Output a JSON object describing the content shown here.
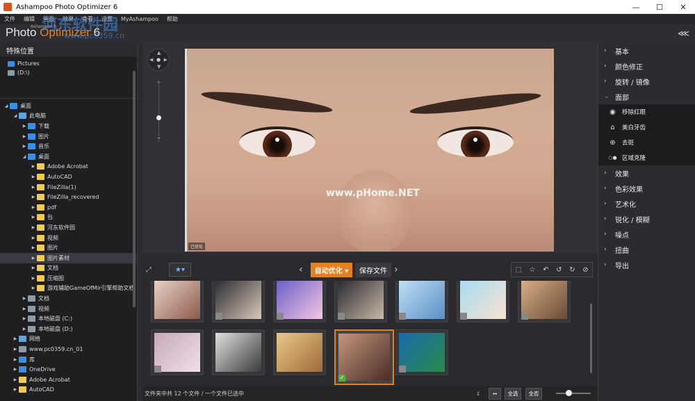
{
  "window": {
    "title": "Ashampoo Photo Optimizer 6",
    "min": "—",
    "max": "☐",
    "close": "✕"
  },
  "menu": [
    "文件",
    "编辑",
    "画面",
    "效果",
    "查看",
    "设置",
    "MyAshampoo",
    "帮助"
  ],
  "logo": {
    "prefix": "Photo ",
    "accent": "Optimizer",
    "version": " 6",
    "brand": "Ashampoo®"
  },
  "watermark": {
    "main": "河东软件园",
    "url": "www.pc0359.cn"
  },
  "left": {
    "title": "特殊位置",
    "special": [
      "Pictures",
      "(D:\\)"
    ],
    "tree": [
      {
        "label": "桌面",
        "indent": 0,
        "arrow": "◢",
        "icon": "blue"
      },
      {
        "label": "此电脑",
        "indent": 1,
        "arrow": "◢",
        "icon": "pc"
      },
      {
        "label": "下载",
        "indent": 2,
        "arrow": "▶",
        "icon": "blue"
      },
      {
        "label": "图片",
        "indent": 2,
        "arrow": "▶",
        "icon": "blue"
      },
      {
        "label": "音乐",
        "indent": 2,
        "arrow": "▶",
        "icon": "blue"
      },
      {
        "label": "桌面",
        "indent": 2,
        "arrow": "◢",
        "icon": "blue"
      },
      {
        "label": "Adobe Acrobat",
        "indent": 3,
        "arrow": "▶",
        "icon": "folder"
      },
      {
        "label": "AutoCAD",
        "indent": 3,
        "arrow": "▶",
        "icon": "folder"
      },
      {
        "label": "FileZilla(1)",
        "indent": 3,
        "arrow": "▶",
        "icon": "folder"
      },
      {
        "label": "FileZilla_recovered",
        "indent": 3,
        "arrow": "▶",
        "icon": "folder"
      },
      {
        "label": "pdf",
        "indent": 3,
        "arrow": "▶",
        "icon": "folder"
      },
      {
        "label": "包",
        "indent": 3,
        "arrow": "▶",
        "icon": "folder"
      },
      {
        "label": "河东软件园",
        "indent": 3,
        "arrow": "▶",
        "icon": "folder"
      },
      {
        "label": "视频",
        "indent": 3,
        "arrow": "▶",
        "icon": "folder"
      },
      {
        "label": "图片",
        "indent": 3,
        "arrow": "▶",
        "icon": "folder"
      },
      {
        "label": "图片素材",
        "indent": 3,
        "arrow": "▶",
        "icon": "folder",
        "selected": true
      },
      {
        "label": "文档",
        "indent": 3,
        "arrow": "▶",
        "icon": "folder"
      },
      {
        "label": "压缩图",
        "indent": 3,
        "arrow": "▶",
        "icon": "folder"
      },
      {
        "label": "游戏辅助GameOfMir引擎帮助文档",
        "indent": 3,
        "arrow": "▶",
        "icon": "folder"
      },
      {
        "label": "文档",
        "indent": 2,
        "arrow": "▶",
        "icon": "drive"
      },
      {
        "label": "视频",
        "indent": 2,
        "arrow": "▶",
        "icon": "drive"
      },
      {
        "label": "本地磁盘 (C:)",
        "indent": 2,
        "arrow": "▶",
        "icon": "drive"
      },
      {
        "label": "本地磁盘 (D:)",
        "indent": 2,
        "arrow": "▶",
        "icon": "drive"
      },
      {
        "label": "网络",
        "indent": 1,
        "arrow": "▶",
        "icon": "pc"
      },
      {
        "label": "www.pc0359.cn_01",
        "indent": 1,
        "arrow": "▶",
        "icon": "drive"
      },
      {
        "label": "库",
        "indent": 1,
        "arrow": "▶",
        "icon": "blue"
      },
      {
        "label": "OneDrive",
        "indent": 1,
        "arrow": "▶",
        "icon": "blue"
      },
      {
        "label": "Adobe Acrobat",
        "indent": 1,
        "arrow": "▶",
        "icon": "folder"
      },
      {
        "label": "AutoCAD",
        "indent": 1,
        "arrow": "▶",
        "icon": "folder"
      }
    ]
  },
  "viewer": {
    "photo_watermark": "www.pHome.NET",
    "badge": "已优化",
    "zoom_plus": "+",
    "zoom_minus": "−"
  },
  "right": {
    "sections_top": [
      "基本",
      "颜色修正",
      "旋转 / 镜像"
    ],
    "open_section": "面部",
    "sub_items": [
      {
        "label": "移除红眼",
        "icon": "◉"
      },
      {
        "label": "美白牙齿",
        "icon": "⌂"
      },
      {
        "label": "去斑",
        "icon": "⊕"
      },
      {
        "label": "区域克隆",
        "icon": "○●"
      }
    ],
    "sections_bottom": [
      "效果",
      "色彩效果",
      "艺术化",
      "锐化 / 模糊",
      "噪点",
      "扭曲",
      "导出"
    ]
  },
  "toolbar": {
    "auto": "自动优化 ▾",
    "save": "保存文件"
  },
  "status": {
    "text": "文件夹中共 12 个文件 / 一个文件已选中",
    "select_all": "全选",
    "select_none": "全否"
  },
  "colors": {
    "accent": "#e5801e",
    "panel": "#2b2b30",
    "dark": "#1f1f22"
  }
}
